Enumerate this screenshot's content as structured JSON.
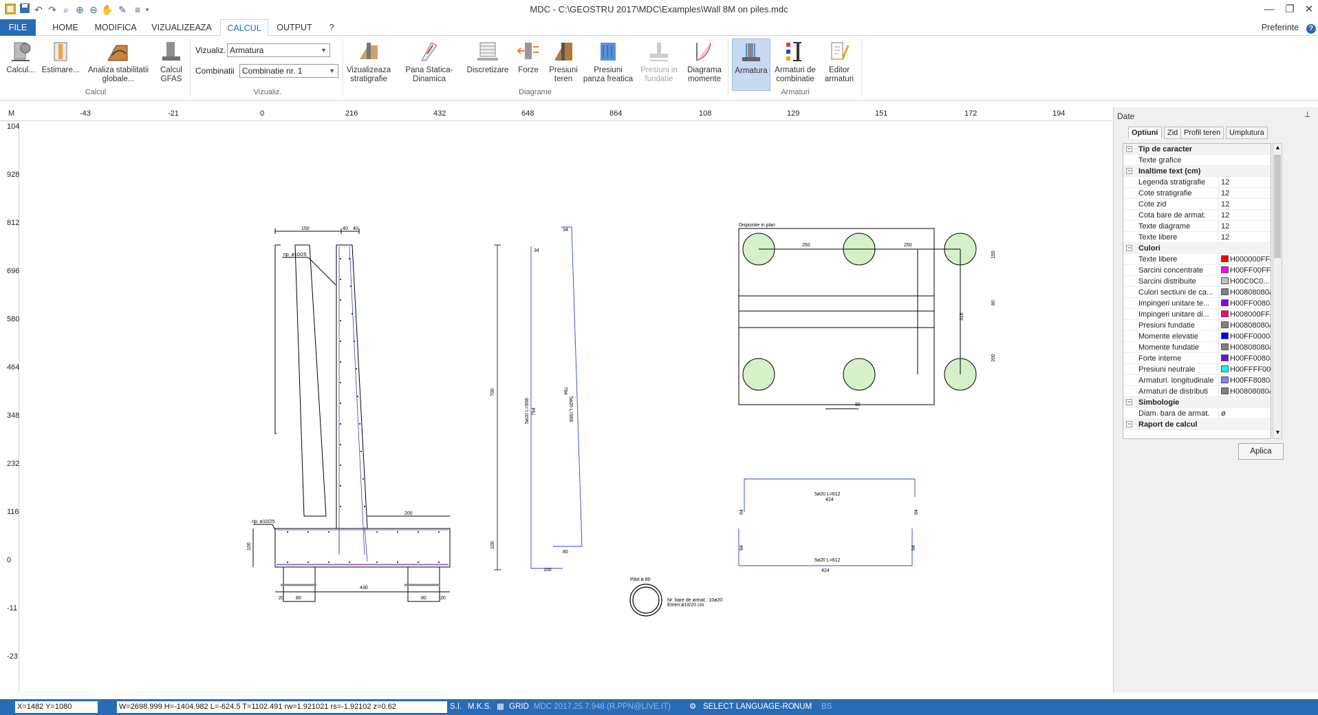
{
  "window": {
    "title": "MDC  - C:\\GEOSTRU 2017\\MDC\\Examples\\Wall 8M on piles.mdc",
    "minimize": "—",
    "restore": "❐",
    "close": "✕"
  },
  "quick_access": [
    "save-icon",
    "undo-icon",
    "redo-icon",
    "zoom-window-icon",
    "zoom-in-icon",
    "zoom-out-icon",
    "pan-icon",
    "paint-icon",
    "layers-icon",
    "dropdown-icon"
  ],
  "tabs": {
    "file": "FILE",
    "items": [
      "HOME",
      "MODIFICA",
      "VIZUALIZEAZA",
      "CALCUL",
      "OUTPUT",
      "?"
    ],
    "active": "CALCUL",
    "preferences": "Preferinte",
    "help": "?"
  },
  "ribbon": {
    "calcul_btn": "Calcul...",
    "estimare_btn": "Estimare...",
    "analiza_btn": "Analiza stabilitatii globale...",
    "gfas_btn": "Calcul GFAS",
    "group_calcul": "Calcul",
    "vizualiz_label": "Vizualiz.",
    "vizualiz_value": "Armatura",
    "combinatii_label": "Combinatii",
    "combinatii_value": "Combinatie nr. 1",
    "group_vizualiz": "Vizualiz.",
    "stratigrafie_btn": "Vizualizeaza stratigrafie",
    "pana_btn": "Pana Statica-Dinamica",
    "discretizare_btn": "Discretizare",
    "forze_btn": "Forze",
    "presiuni_teren_btn": "Presiuni teren",
    "presiuni_panza_btn": "Presiuni panza freatica",
    "presiuni_fundatie_btn": "Presiuni in fundatie",
    "diagrama_btn": "Diagrama momente",
    "group_diagrame": "Diagrame",
    "armatura_btn": "Armatura",
    "armaturi_comb_btn": "Armaturi de combinatie",
    "editor_btn": "Editor armaturi",
    "group_armaturi": "Armaturi"
  },
  "ruler": {
    "corner": "M",
    "top_ticks": [
      "-43",
      "-21",
      "0",
      "216",
      "432",
      "648",
      "864",
      "108",
      "129",
      "151",
      "172",
      "194"
    ],
    "left_ticks": [
      "104",
      "928",
      "812",
      "696",
      "580",
      "464",
      "348",
      "232",
      "116",
      "0",
      "-11",
      "-23"
    ]
  },
  "drawing": {
    "wall_dims": [
      "150",
      "40",
      "40"
    ],
    "rip_top": "rip. ø10/25",
    "rip_bottom": "rip. ø10/25",
    "heel_dim": "200",
    "base_dim": "430",
    "pile_dims": [
      "20",
      "80",
      "80",
      "20"
    ],
    "base_h": "100",
    "bar1_top": "34",
    "bar1_label": "5ø20 L=908",
    "bar1_len": "794",
    "bar1_bottom": "80",
    "bar1_base": "100",
    "bar1_total": "700",
    "bar2_top": "34",
    "bar2_label": "5ø20 L=906",
    "bar2_len": "794",
    "bar2_bottom": "80",
    "plan_title": "Dispozitie in plan",
    "plan_spacing1": "250",
    "plan_spacing2": "250",
    "plan_right1": "150",
    "plan_right2": "80",
    "plan_right3": "200",
    "plan_vert": "316",
    "plan_bottom": "80",
    "stirrup_top_label": "5ø20 L=612",
    "stirrup_top_len": "424",
    "stirrup_bot_label": "5ø20 L=612",
    "stirrup_bot_len": "424",
    "stirrup_side": "94",
    "pile_title": "Pilot ø 80",
    "pile_bars": "Nr. bare de armat.: 10ø20",
    "pile_stirrups": "Etrieri:ø10/20 cm"
  },
  "panel": {
    "title": "Date",
    "pin": "⊥",
    "tabs": [
      "Optiuni",
      "Zid",
      "Profil teren",
      "Umplutura"
    ],
    "rows": [
      {
        "cat": true,
        "name": "Tip de caracter"
      },
      {
        "name": "Texte grafice",
        "value": ""
      },
      {
        "cat": true,
        "name": "Inaltime text (cm)"
      },
      {
        "name": "Legenda stratigrafie",
        "value": "12"
      },
      {
        "name": "Cote stratigrafie",
        "value": "12"
      },
      {
        "name": "Cote zid",
        "value": "12"
      },
      {
        "name": "Cota bare de armat.",
        "value": "12"
      },
      {
        "name": "Texte diagrame",
        "value": "12"
      },
      {
        "name": "Texte libere",
        "value": "12"
      },
      {
        "cat": true,
        "name": "Culori"
      },
      {
        "name": "Texte libere",
        "value": "H000000FF&",
        "color": "#ff0000"
      },
      {
        "name": "Sarcini concentrate",
        "value": "H00FF00FF&",
        "color": "#ff00ff"
      },
      {
        "name": "Sarcini distribuite",
        "value": "H00C0C0...",
        "color": "#c0c0c0"
      },
      {
        "name": "Culori sectiuni de ca...",
        "value": "H00808080&",
        "color": "#808080"
      },
      {
        "name": "Impingeri unitare te...",
        "value": "H00FF0080&",
        "color": "#8000ff"
      },
      {
        "name": "Impingeri unitare di...",
        "value": "H008000FF&",
        "color": "#ff0080"
      },
      {
        "name": "Presiuni fundatie",
        "value": "H00808080&",
        "color": "#808080"
      },
      {
        "name": "Momente elevatie",
        "value": "H00FF0000&",
        "color": "#0000ff"
      },
      {
        "name": "Momente fundatie",
        "value": "H00808080&",
        "color": "#808080"
      },
      {
        "name": "Forte interne",
        "value": "H00FF0080&",
        "color": "#8000ff"
      },
      {
        "name": "Presiuni neutrale",
        "value": "H00FFFF00&",
        "color": "#00ffff"
      },
      {
        "name": "Armaturi. longitudinale",
        "value": "H00FF8080&",
        "color": "#8080ff"
      },
      {
        "name": "Armaturi de distributi",
        "value": "H00808080&",
        "color": "#808080"
      },
      {
        "cat": true,
        "name": "Simbologie"
      },
      {
        "name": "Diam. bara de armat.",
        "value": "ø"
      },
      {
        "cat": true,
        "name": "Raport de calcul"
      }
    ],
    "apply": "Aplica"
  },
  "status": {
    "coords": "X=1482  Y=1080",
    "info": "W=2698.999 H=-1404.982 L=-624.5 T=1102.491 rw=1.921021 rs=-1.92102 z=0.62",
    "units1": "S.I.",
    "units2": "M.K.S.",
    "grid": "GRID",
    "version": "MDC  2017.25.7.948 (R.PPN@LIVE.IT)",
    "language": "SELECT LANGUAGE-RO",
    "num": "NUM",
    "bs": "BS"
  }
}
